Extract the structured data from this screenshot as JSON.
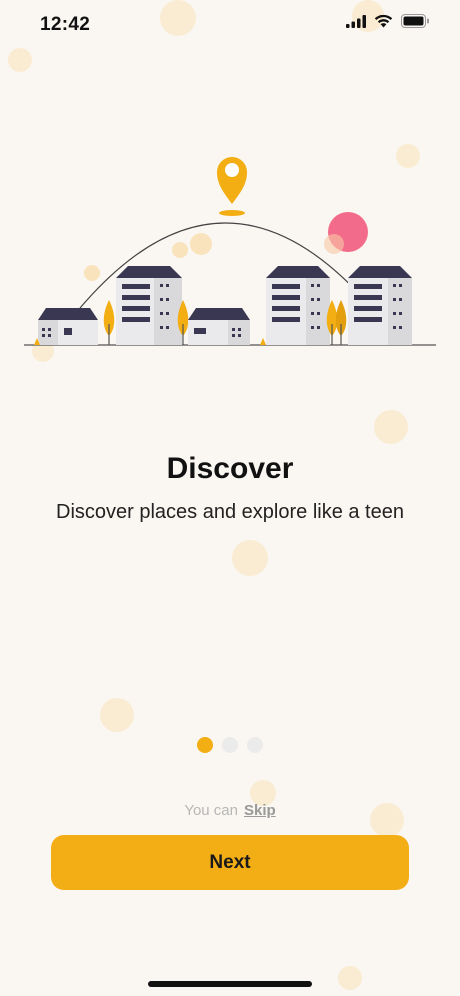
{
  "status_bar": {
    "time": "12:42",
    "icons": [
      "signal-icon",
      "wifi-icon",
      "battery-icon"
    ]
  },
  "illustration": {
    "icon": "city-location-illustration",
    "colors": {
      "accent": "#f2ae13",
      "building_roof": "#3a3752",
      "building_wall": "#d9d9dc",
      "sun": "#f26b8a"
    }
  },
  "onboarding": {
    "title": "Discover",
    "subtitle": "Discover places and explore like a teen",
    "page_count": 3,
    "current_page": 1
  },
  "skip": {
    "prefix": "You can",
    "link_label": "Skip"
  },
  "next_button": {
    "label": "Next"
  },
  "colors": {
    "background": "#faf6f1",
    "accent": "#f4ae15",
    "inactive_dot": "#ecebec"
  }
}
